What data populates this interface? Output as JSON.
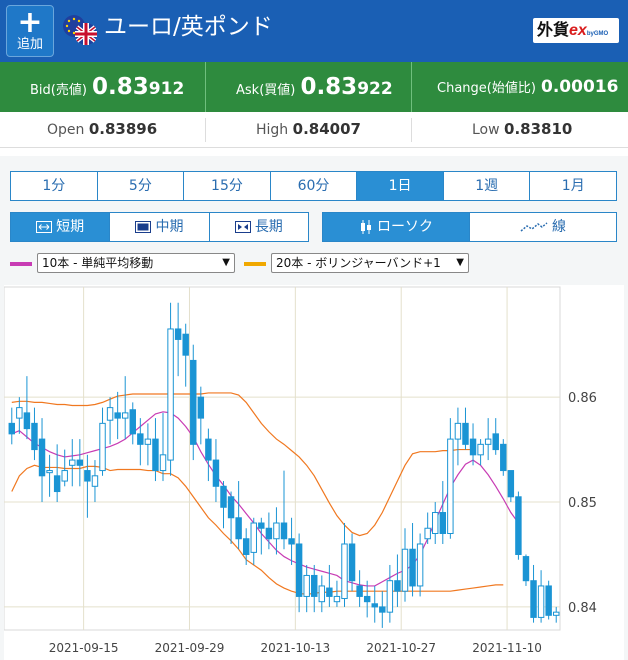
{
  "header": {
    "add_label": "追加",
    "add_icon": "plus-icon",
    "pair_title": "ユーロ/英ポンド",
    "brand_main": "外貨",
    "brand_ex": "ex",
    "brand_sub": "byGMO"
  },
  "quote": {
    "bid_label": "Bid(売値)",
    "bid_main": "0.83",
    "bid_pips": "912",
    "ask_label": "Ask(買値)",
    "ask_main": "0.83",
    "ask_pips": "922",
    "change_label": "Change(始値比)",
    "change_value": "0.00016"
  },
  "ohl": {
    "open_label": "Open",
    "open_main": "0.83",
    "open_pips": "896",
    "high_label": "High",
    "high_main": "0.84",
    "high_pips": "007",
    "low_label": "Low",
    "low_main": "0.83",
    "low_pips": "810"
  },
  "timeframes": [
    "1分",
    "5分",
    "15分",
    "60分",
    "1日",
    "1週",
    "1月"
  ],
  "active_timeframe": 4,
  "periods": {
    "short": "短期",
    "mid": "中期",
    "long": "長期",
    "active": "short"
  },
  "chart_types": {
    "candle": "ローソク",
    "line": "線",
    "active": "candle"
  },
  "indicators": {
    "ma_select": "10本 - 単純平均移動",
    "ma_color": "#c83cb4",
    "bb_select": "20本 - ボリンジャーバンド+1",
    "bb_color": "#f0a800"
  },
  "colors": {
    "header_bg": "#1a5fb4",
    "quote_bg": "#2e8b3e",
    "active_button": "#2a8fd4",
    "candle": "#1a94d4",
    "bollinger": "#f07820",
    "moving_average": "#c83cb4"
  },
  "chart_data": {
    "type": "candlestick",
    "x_tick_labels": [
      "2021-09-15",
      "2021-09-29",
      "2021-10-13",
      "2021-10-27",
      "2021-11-10"
    ],
    "y_tick_labels": [
      "0.86",
      "0.85",
      "0.84"
    ],
    "ylim": [
      0.8378,
      0.8705
    ],
    "grid": true,
    "y_axis_side": "right",
    "candles": [
      [
        0.8575,
        0.859,
        0.8555,
        0.8565
      ],
      [
        0.858,
        0.86,
        0.8565,
        0.859
      ],
      [
        0.8585,
        0.862,
        0.856,
        0.857
      ],
      [
        0.8575,
        0.859,
        0.854,
        0.855
      ],
      [
        0.856,
        0.858,
        0.85,
        0.8525
      ],
      [
        0.8528,
        0.8545,
        0.8505,
        0.853
      ],
      [
        0.8525,
        0.8555,
        0.85,
        0.851
      ],
      [
        0.852,
        0.855,
        0.8515,
        0.853
      ],
      [
        0.8535,
        0.856,
        0.8515,
        0.854
      ],
      [
        0.854,
        0.856,
        0.8515,
        0.8535
      ],
      [
        0.853,
        0.8545,
        0.8485,
        0.852
      ],
      [
        0.8515,
        0.854,
        0.85,
        0.8525
      ],
      [
        0.853,
        0.859,
        0.8525,
        0.8575
      ],
      [
        0.8578,
        0.86,
        0.8555,
        0.859
      ],
      [
        0.8585,
        0.8605,
        0.856,
        0.858
      ],
      [
        0.858,
        0.862,
        0.856,
        0.8585
      ],
      [
        0.8588,
        0.8595,
        0.8555,
        0.8565
      ],
      [
        0.8565,
        0.858,
        0.8535,
        0.8555
      ],
      [
        0.8555,
        0.8575,
        0.8535,
        0.856
      ],
      [
        0.856,
        0.858,
        0.852,
        0.853
      ],
      [
        0.853,
        0.8585,
        0.852,
        0.8545
      ],
      [
        0.854,
        0.869,
        0.8525,
        0.8665
      ],
      [
        0.8665,
        0.869,
        0.862,
        0.8655
      ],
      [
        0.866,
        0.867,
        0.861,
        0.864
      ],
      [
        0.8635,
        0.865,
        0.854,
        0.8555
      ],
      [
        0.86,
        0.861,
        0.8555,
        0.858
      ],
      [
        0.856,
        0.857,
        0.852,
        0.854
      ],
      [
        0.854,
        0.856,
        0.85,
        0.8515
      ],
      [
        0.8515,
        0.852,
        0.8475,
        0.8495
      ],
      [
        0.8505,
        0.851,
        0.846,
        0.8485
      ],
      [
        0.8485,
        0.852,
        0.8455,
        0.8465
      ],
      [
        0.8465,
        0.8475,
        0.844,
        0.845
      ],
      [
        0.8452,
        0.8485,
        0.844,
        0.848
      ],
      [
        0.848,
        0.8485,
        0.845,
        0.8475
      ],
      [
        0.8475,
        0.849,
        0.8455,
        0.8465
      ],
      [
        0.8465,
        0.8495,
        0.845,
        0.848
      ],
      [
        0.848,
        0.853,
        0.8455,
        0.8465
      ],
      [
        0.8465,
        0.8485,
        0.844,
        0.846
      ],
      [
        0.846,
        0.847,
        0.8395,
        0.841
      ],
      [
        0.841,
        0.844,
        0.8395,
        0.843
      ],
      [
        0.843,
        0.844,
        0.8395,
        0.841
      ],
      [
        0.8405,
        0.843,
        0.8395,
        0.842
      ],
      [
        0.8418,
        0.844,
        0.84,
        0.841
      ],
      [
        0.8405,
        0.8425,
        0.84,
        0.841
      ],
      [
        0.8408,
        0.848,
        0.84,
        0.846
      ],
      [
        0.846,
        0.847,
        0.8415,
        0.8425
      ],
      [
        0.842,
        0.8435,
        0.84,
        0.841
      ],
      [
        0.841,
        0.8425,
        0.839,
        0.8405
      ],
      [
        0.8403,
        0.842,
        0.8385,
        0.84
      ],
      [
        0.84,
        0.8415,
        0.838,
        0.8395
      ],
      [
        0.8395,
        0.844,
        0.8385,
        0.8425
      ],
      [
        0.8425,
        0.845,
        0.84,
        0.8415
      ],
      [
        0.8415,
        0.8475,
        0.8405,
        0.8455
      ],
      [
        0.8455,
        0.848,
        0.841,
        0.842
      ],
      [
        0.842,
        0.847,
        0.841,
        0.846
      ],
      [
        0.8465,
        0.849,
        0.846,
        0.8475
      ],
      [
        0.847,
        0.85,
        0.846,
        0.849
      ],
      [
        0.849,
        0.852,
        0.846,
        0.847
      ],
      [
        0.847,
        0.858,
        0.8465,
        0.856
      ],
      [
        0.856,
        0.859,
        0.8535,
        0.8575
      ],
      [
        0.8575,
        0.859,
        0.855,
        0.8555
      ],
      [
        0.856,
        0.8575,
        0.8535,
        0.8545
      ],
      [
        0.8545,
        0.856,
        0.8535,
        0.8555
      ],
      [
        0.8555,
        0.858,
        0.854,
        0.856
      ],
      [
        0.8565,
        0.858,
        0.8545,
        0.855
      ],
      [
        0.8555,
        0.856,
        0.8525,
        0.853
      ],
      [
        0.853,
        0.853,
        0.85,
        0.8505
      ],
      [
        0.8505,
        0.851,
        0.8445,
        0.845
      ],
      [
        0.8448,
        0.845,
        0.842,
        0.8425
      ],
      [
        0.8425,
        0.844,
        0.8385,
        0.839
      ],
      [
        0.839,
        0.8435,
        0.8385,
        0.842
      ],
      [
        0.842,
        0.8425,
        0.8388,
        0.8392
      ],
      [
        0.8392,
        0.84,
        0.8385,
        0.8395
      ]
    ],
    "moving_average": [
      0.8565,
      0.8568,
      0.8562,
      0.8556,
      0.8552,
      0.8548,
      0.8545,
      0.8543,
      0.8544,
      0.8545,
      0.8547,
      0.8549,
      0.8551,
      0.8553,
      0.8556,
      0.856,
      0.8566,
      0.8572,
      0.8578,
      0.8584,
      0.8586,
      0.8585,
      0.858,
      0.8572,
      0.8562,
      0.8548,
      0.8536,
      0.8525,
      0.8516,
      0.8506,
      0.8498,
      0.8489,
      0.848,
      0.847,
      0.8462,
      0.8454,
      0.8448,
      0.8444,
      0.8441,
      0.8438,
      0.8436,
      0.8434,
      0.8432,
      0.843,
      0.8425,
      0.8423,
      0.8421,
      0.842,
      0.842,
      0.8424,
      0.8428,
      0.8432,
      0.8435,
      0.844,
      0.845,
      0.8465,
      0.8482,
      0.8498,
      0.8514,
      0.8526,
      0.8536,
      0.854,
      0.8535,
      0.8526,
      0.8515,
      0.8503,
      0.849,
      0.848
    ],
    "bollinger_upper": [
      0.8595,
      0.8596,
      0.8596,
      0.8595,
      0.8595,
      0.8594,
      0.8593,
      0.8593,
      0.8592,
      0.8592,
      0.8592,
      0.8593,
      0.8595,
      0.8598,
      0.8601,
      0.8602,
      0.8603,
      0.8603,
      0.8603,
      0.8603,
      0.8603,
      0.8603,
      0.8603,
      0.8603,
      0.8603,
      0.8603,
      0.8604,
      0.8604,
      0.8604,
      0.8604,
      0.8602,
      0.8595,
      0.8585,
      0.8575,
      0.8567,
      0.856,
      0.8555,
      0.8549,
      0.8543,
      0.8535,
      0.8525,
      0.8512,
      0.8499,
      0.8487,
      0.8478,
      0.8471,
      0.8468,
      0.847,
      0.8478,
      0.849,
      0.8505,
      0.852,
      0.8535,
      0.8546,
      0.8548,
      0.8548,
      0.8548,
      0.8549,
      0.8549,
      0.855,
      0.855,
      0.855
    ],
    "bollinger_lower": [
      0.851,
      0.8525,
      0.8532,
      0.8535,
      0.8533,
      0.8533,
      0.8533,
      0.8532,
      0.8532,
      0.8532,
      0.8534,
      0.8534,
      0.8533,
      0.853,
      0.8531,
      0.8531,
      0.8531,
      0.8531,
      0.853,
      0.853,
      0.8527,
      0.8527,
      0.8523,
      0.8515,
      0.8505,
      0.8495,
      0.8485,
      0.8478,
      0.847,
      0.8463,
      0.8455,
      0.8445,
      0.844,
      0.8435,
      0.8428,
      0.8422,
      0.8418,
      0.8415,
      0.8413,
      0.8412,
      0.8413,
      0.8414,
      0.8414,
      0.8415,
      0.8415,
      0.8415,
      0.8415,
      0.8415,
      0.8415,
      0.8415,
      0.8415,
      0.8415,
      0.8415,
      0.8415,
      0.8415,
      0.8415,
      0.8415,
      0.8415,
      0.8415,
      0.8416,
      0.8417,
      0.8418,
      0.8419,
      0.842,
      0.8421,
      0.8421
    ]
  }
}
